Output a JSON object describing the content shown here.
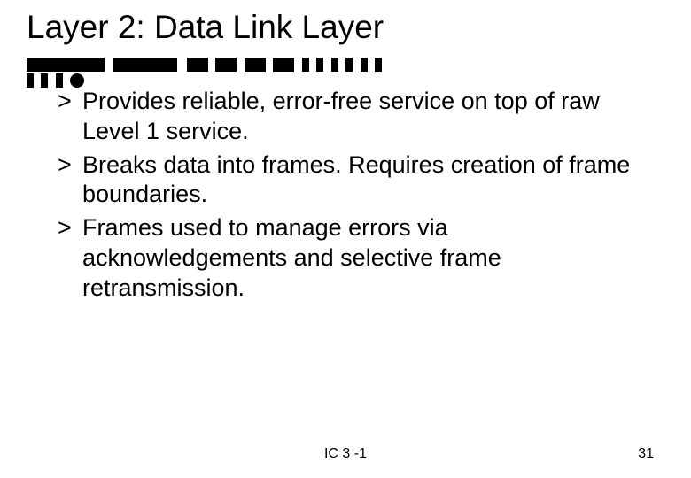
{
  "title": "Layer 2:  Data Link Layer",
  "bullets": [
    {
      "marker": ">",
      "text": "Provides reliable, error-free service on top of raw Level 1 service."
    },
    {
      "marker": ">",
      "text": "Breaks data into frames.  Requires creation of frame boundaries."
    },
    {
      "marker": ">",
      "text": "Frames used to manage errors via acknowledgements and selective frame retransmission."
    }
  ],
  "footer": {
    "center": "IC 3 -1",
    "page": "31"
  }
}
